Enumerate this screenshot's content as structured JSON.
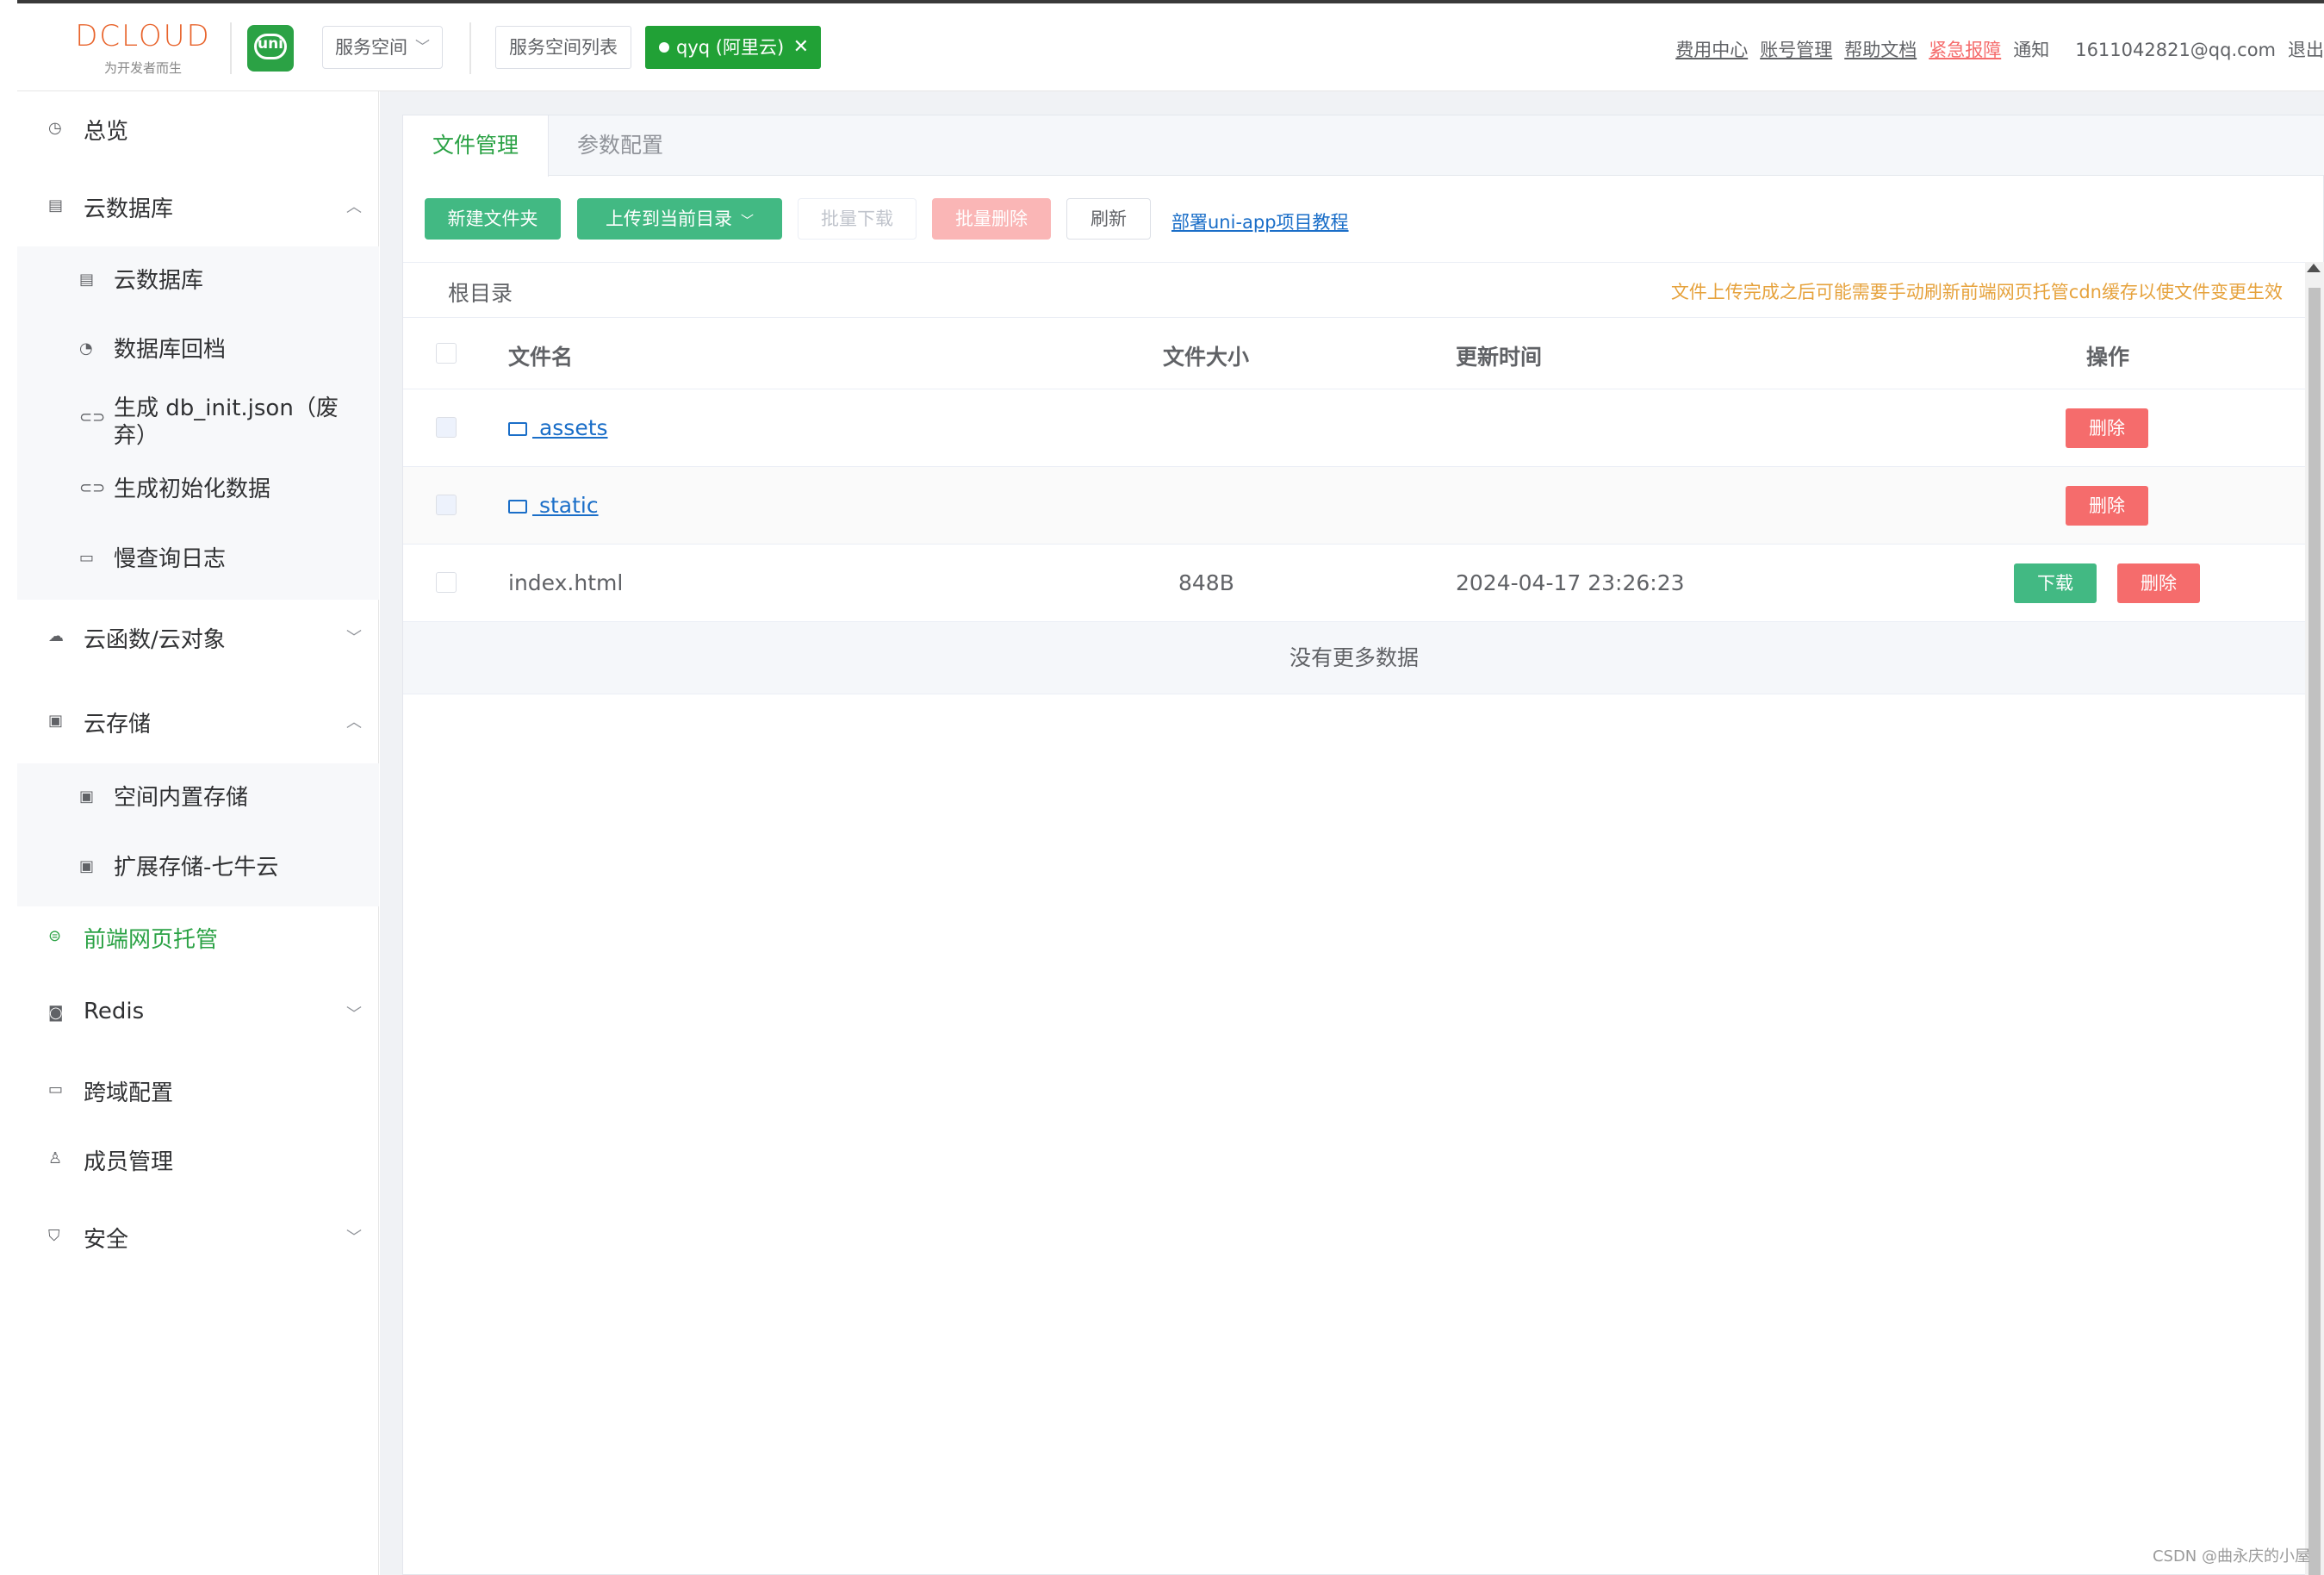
{
  "header": {
    "logo_main": "DCLOUD",
    "logo_sub": "为开发者而生",
    "uni_badge": "uni",
    "space_select": "服务空间",
    "space_list": "服务空间列表",
    "current_space": "qyq (阿里云)",
    "links": {
      "billing": "费用中心",
      "account": "账号管理",
      "docs": "帮助文档",
      "emergency": "紧急报障",
      "notify": "通知",
      "email": "1611042821@qq.com",
      "logout": "退出"
    }
  },
  "sidebar": {
    "overview": "总览",
    "clouddb": "云数据库",
    "clouddb_sub": {
      "db": "云数据库",
      "backup": "数据库回档",
      "gen_init": "生成 db_init.json（废弃）",
      "gen_data": "生成初始化数据",
      "slow_log": "慢查询日志"
    },
    "cloudfunc": "云函数/云对象",
    "storage": "云存储",
    "storage_sub": {
      "builtin": "空间内置存储",
      "qiniu": "扩展存储-七牛云"
    },
    "hosting": "前端网页托管",
    "redis": "Redis",
    "cors": "跨域配置",
    "members": "成员管理",
    "security": "安全"
  },
  "main": {
    "tabs": [
      "文件管理",
      "参数配置"
    ],
    "toolbar": {
      "new_folder": "新建文件夹",
      "upload": "上传到当前目录",
      "batch_download": "批量下载",
      "batch_delete": "批量删除",
      "refresh": "刷新",
      "tutorial": "部署uni-app项目教程"
    },
    "path_root": "根目录",
    "notice": "文件上传完成之后可能需要手动刷新前端网页托管cdn缓存以使文件变更生效",
    "columns": {
      "name": "文件名",
      "size": "文件大小",
      "updated": "更新时间",
      "actions": "操作"
    },
    "rows": [
      {
        "name": " assets",
        "size": "",
        "updated": "",
        "type": "folder"
      },
      {
        "name": " static",
        "size": "",
        "updated": "",
        "type": "folder"
      },
      {
        "name": "index.html",
        "size": "848B",
        "updated": "2024-04-17 23:26:23",
        "type": "file"
      }
    ],
    "download_label": "下载",
    "delete_label": "删除",
    "empty_text": "没有更多数据"
  },
  "watermark": "CSDN @曲永庆的小屋",
  "colors": {
    "brand_green": "#2ba245",
    "button_green": "#42b983",
    "danger": "#f56c6c",
    "warning": "#e6a23c",
    "link": "#1a6ec8"
  }
}
